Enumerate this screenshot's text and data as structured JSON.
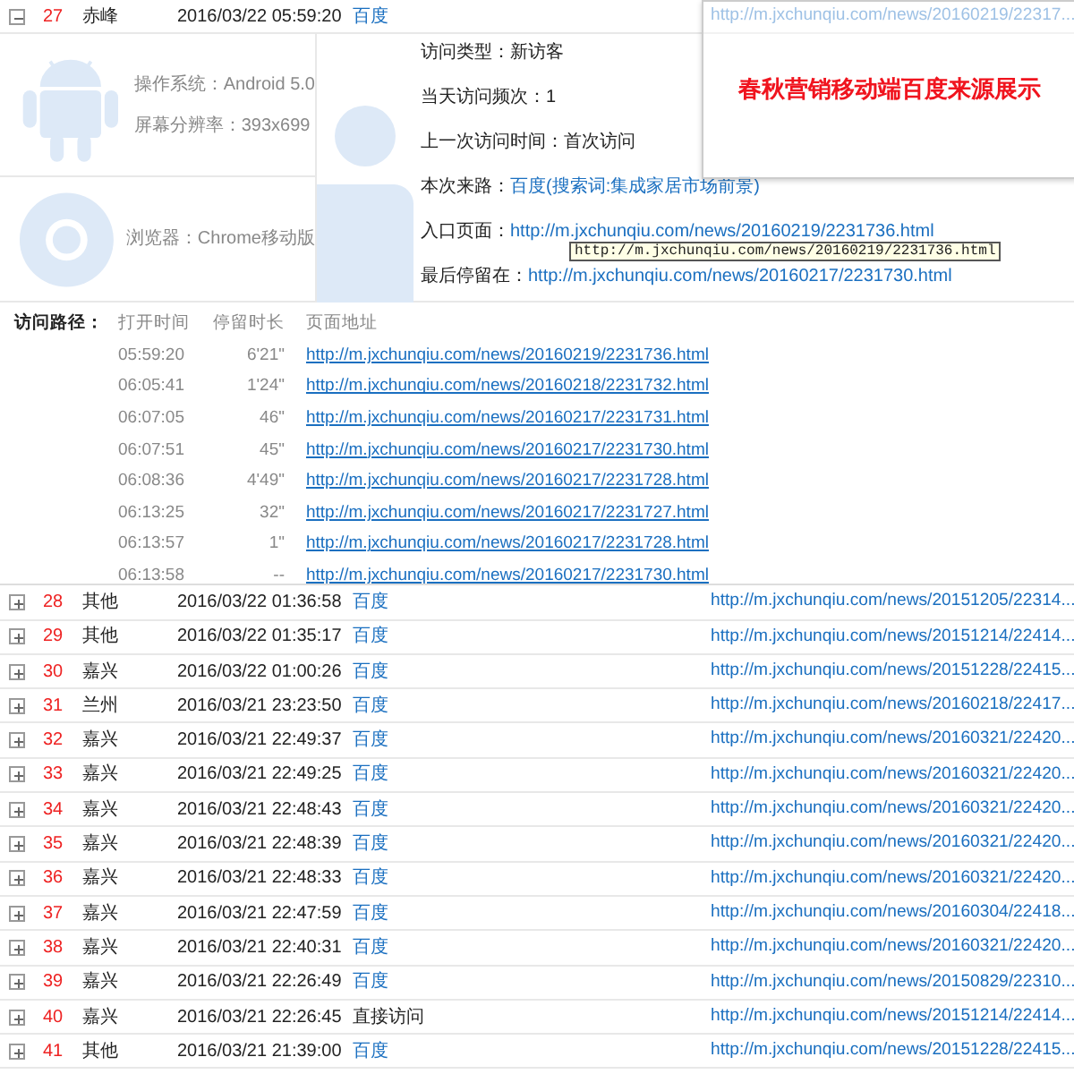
{
  "expanded_row": {
    "expanded": true,
    "number": "27",
    "city": "赤峰",
    "time": "2016/03/22 05:59:20",
    "source": "百度",
    "source_link": true,
    "url": "http://m.jxchunqiu.com/news/20160219/22317...",
    "device": {
      "os": "操作系统：Android 5.0",
      "resolution": "屏幕分辨率：393x699",
      "browser": "浏览器：Chrome移动版"
    },
    "visit_info": [
      {
        "label": "访问类型：",
        "value": "新访客",
        "kind": "text"
      },
      {
        "label": "当天访问频次：",
        "value": "1",
        "kind": "text"
      },
      {
        "label": "上一次访问时间：",
        "value": "首次访问",
        "kind": "text"
      },
      {
        "label": "本次来路：",
        "value": "百度(搜索词:集成家居市场前景)",
        "kind": "link"
      },
      {
        "label": "入口页面：",
        "value": "http://m.jxchunqiu.com/news/20160219/2231736.html",
        "kind": "link"
      },
      {
        "label": "最后停留在：",
        "value": "http://m.jxchunqiu.com/news/20160217/2231730.html",
        "kind": "link"
      }
    ],
    "tooltip": "http://m.jxchunqiu.com/news/20160219/2231736.html",
    "path": {
      "label": "访问路径：",
      "columns": [
        "打开时间",
        "停留时长",
        "页面地址"
      ],
      "rows": [
        [
          "05:59:20",
          "6'21\"",
          "http://m.jxchunqiu.com/news/20160219/2231736.html"
        ],
        [
          "06:05:41",
          "1'24\"",
          "http://m.jxchunqiu.com/news/20160218/2231732.html"
        ],
        [
          "06:07:05",
          "46\"",
          "http://m.jxchunqiu.com/news/20160217/2231731.html"
        ],
        [
          "06:07:51",
          "45\"",
          "http://m.jxchunqiu.com/news/20160217/2231730.html"
        ],
        [
          "06:08:36",
          "4'49\"",
          "http://m.jxchunqiu.com/news/20160217/2231728.html"
        ],
        [
          "06:13:25",
          "32\"",
          "http://m.jxchunqiu.com/news/20160217/2231727.html"
        ],
        [
          "06:13:57",
          "1\"",
          "http://m.jxchunqiu.com/news/20160217/2231728.html"
        ],
        [
          "06:13:58",
          "--",
          "http://m.jxchunqiu.com/news/20160217/2231730.html"
        ]
      ]
    }
  },
  "overlay_title": "春秋营销移动端百度来源展示",
  "rows": [
    {
      "expanded": false,
      "number": "28",
      "city": "其他",
      "time": "2016/03/22 01:36:58",
      "source": "百度",
      "source_link": true,
      "url": "http://m.jxchunqiu.com/news/20151205/22314..."
    },
    {
      "expanded": false,
      "number": "29",
      "city": "其他",
      "time": "2016/03/22 01:35:17",
      "source": "百度",
      "source_link": true,
      "url": "http://m.jxchunqiu.com/news/20151214/22414..."
    },
    {
      "expanded": false,
      "number": "30",
      "city": "嘉兴",
      "time": "2016/03/22 01:00:26",
      "source": "百度",
      "source_link": true,
      "url": "http://m.jxchunqiu.com/news/20151228/22415..."
    },
    {
      "expanded": false,
      "number": "31",
      "city": "兰州",
      "time": "2016/03/21 23:23:50",
      "source": "百度",
      "source_link": true,
      "url": "http://m.jxchunqiu.com/news/20160218/22417..."
    },
    {
      "expanded": false,
      "number": "32",
      "city": "嘉兴",
      "time": "2016/03/21 22:49:37",
      "source": "百度",
      "source_link": true,
      "url": "http://m.jxchunqiu.com/news/20160321/22420..."
    },
    {
      "expanded": false,
      "number": "33",
      "city": "嘉兴",
      "time": "2016/03/21 22:49:25",
      "source": "百度",
      "source_link": true,
      "url": "http://m.jxchunqiu.com/news/20160321/22420..."
    },
    {
      "expanded": false,
      "number": "34",
      "city": "嘉兴",
      "time": "2016/03/21 22:48:43",
      "source": "百度",
      "source_link": true,
      "url": "http://m.jxchunqiu.com/news/20160321/22420..."
    },
    {
      "expanded": false,
      "number": "35",
      "city": "嘉兴",
      "time": "2016/03/21 22:48:39",
      "source": "百度",
      "source_link": true,
      "url": "http://m.jxchunqiu.com/news/20160321/22420..."
    },
    {
      "expanded": false,
      "number": "36",
      "city": "嘉兴",
      "time": "2016/03/21 22:48:33",
      "source": "百度",
      "source_link": true,
      "url": "http://m.jxchunqiu.com/news/20160321/22420..."
    },
    {
      "expanded": false,
      "number": "37",
      "city": "嘉兴",
      "time": "2016/03/21 22:47:59",
      "source": "百度",
      "source_link": true,
      "url": "http://m.jxchunqiu.com/news/20160304/22418..."
    },
    {
      "expanded": false,
      "number": "38",
      "city": "嘉兴",
      "time": "2016/03/21 22:40:31",
      "source": "百度",
      "source_link": true,
      "url": "http://m.jxchunqiu.com/news/20160321/22420..."
    },
    {
      "expanded": false,
      "number": "39",
      "city": "嘉兴",
      "time": "2016/03/21 22:26:49",
      "source": "百度",
      "source_link": true,
      "url": "http://m.jxchunqiu.com/news/20150829/22310..."
    },
    {
      "expanded": false,
      "number": "40",
      "city": "嘉兴",
      "time": "2016/03/21 22:26:45",
      "source": "直接访问",
      "source_link": false,
      "url": "http://m.jxchunqiu.com/news/20151214/22414..."
    },
    {
      "expanded": false,
      "number": "41",
      "city": "其他",
      "time": "2016/03/21 21:39:00",
      "source": "百度",
      "source_link": true,
      "url": "http://m.jxchunqiu.com/news/20151228/22415..."
    }
  ]
}
